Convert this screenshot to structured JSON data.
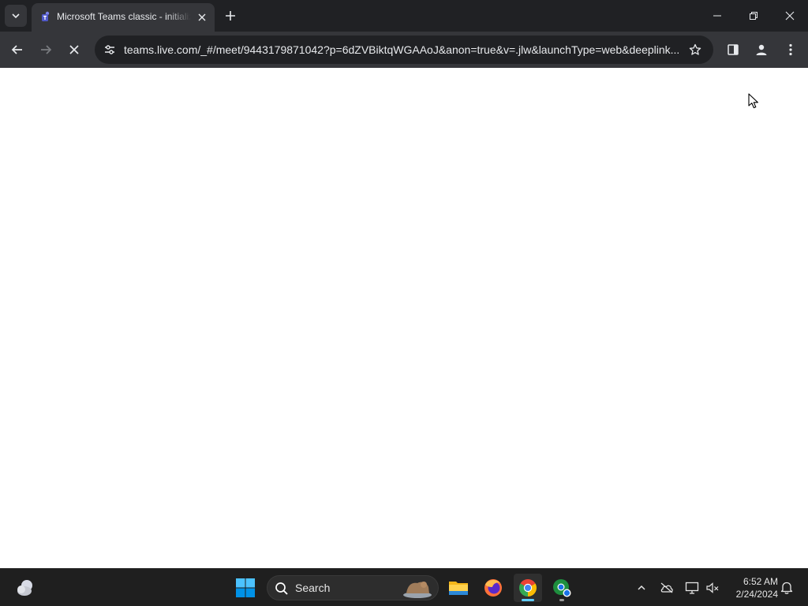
{
  "browser": {
    "tab": {
      "title": "Microsoft Teams classic - initializing",
      "favicon": "teams-icon"
    },
    "address_bar": {
      "url": "teams.live.com/_#/meet/9443179871042?p=6dZVBiktqWGAAoJ&anon=true&v=.jlw&launchType=web&deeplink..."
    },
    "page_state": "loading"
  },
  "taskbar": {
    "search_label": "Search",
    "clock_time": "6:52 AM",
    "clock_date": "2/24/2024",
    "apps": [
      "file-explorer",
      "firefox",
      "chrome",
      "chrome-beta"
    ],
    "active_app": "chrome"
  },
  "colors": {
    "tabstrip_bg": "#202124",
    "toolbar_bg": "#35363a",
    "taskbar_bg": "#1f1f1f",
    "chrome_accent": "#8ab4f8"
  }
}
